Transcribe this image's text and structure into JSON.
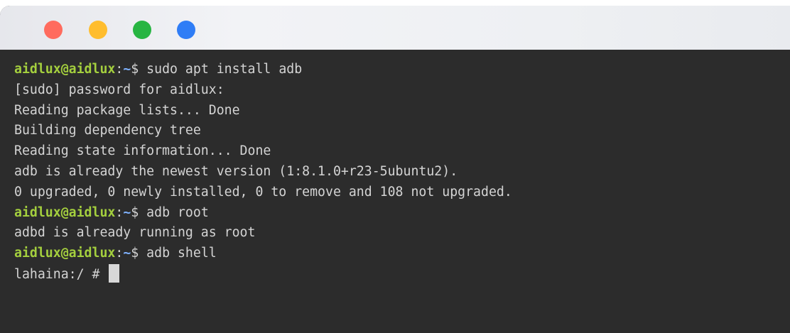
{
  "window": {
    "traffic_lights": [
      {
        "name": "close-dot",
        "color": "#ff6b5e"
      },
      {
        "name": "minimize-dot",
        "color": "#ffbd2e"
      },
      {
        "name": "maximize-dot",
        "color": "#27b542"
      },
      {
        "name": "extra-dot",
        "color": "#2f7df6"
      }
    ]
  },
  "terminal": {
    "colors": {
      "background": "#2c2c2c",
      "text": "#d4d4d4",
      "user": "#a4cf3e",
      "path": "#7fb2ff"
    },
    "lines": [
      {
        "type": "prompt",
        "user": "aidlux@aidlux",
        "sep": ":",
        "path": "~",
        "symbol": "$",
        "command": "sudo apt install adb"
      },
      {
        "type": "output",
        "text": "[sudo] password for aidlux:"
      },
      {
        "type": "output",
        "text": "Reading package lists... Done"
      },
      {
        "type": "output",
        "text": "Building dependency tree"
      },
      {
        "type": "output",
        "text": "Reading state information... Done"
      },
      {
        "type": "output",
        "text": "adb is already the newest version (1:8.1.0+r23-5ubuntu2)."
      },
      {
        "type": "output",
        "text": "0 upgraded, 0 newly installed, 0 to remove and 108 not upgraded."
      },
      {
        "type": "prompt",
        "user": "aidlux@aidlux",
        "sep": ":",
        "path": "~",
        "symbol": "$",
        "command": "adb root"
      },
      {
        "type": "output",
        "text": "adbd is already running as root"
      },
      {
        "type": "prompt",
        "user": "aidlux@aidlux",
        "sep": ":",
        "path": "~",
        "symbol": "$",
        "command": "adb shell"
      },
      {
        "type": "shell",
        "text": "lahaina:/ # "
      }
    ]
  }
}
